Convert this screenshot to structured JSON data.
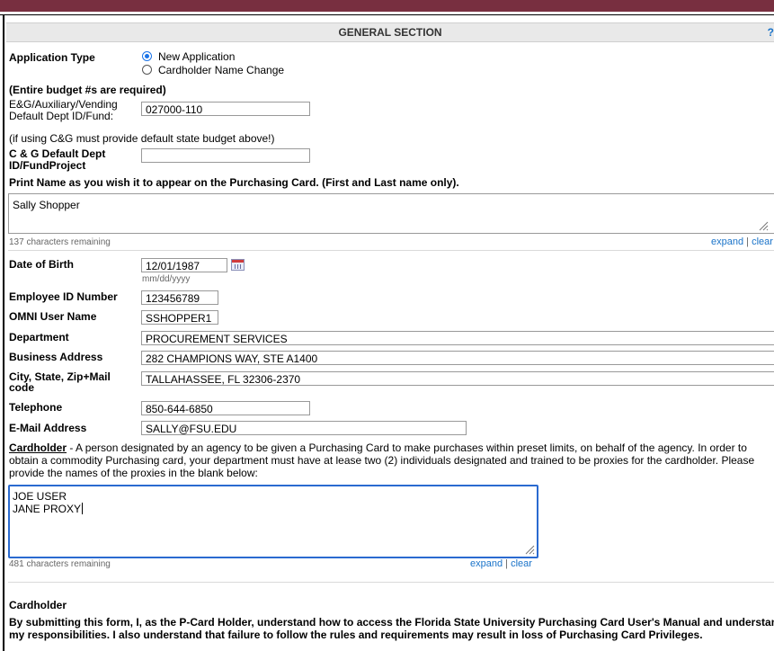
{
  "section": {
    "title": "GENERAL SECTION",
    "help": "?"
  },
  "application_type": {
    "label": "Application Type",
    "options": [
      {
        "label": "New Application",
        "selected": true
      },
      {
        "label": "Cardholder Name Change",
        "selected": false
      }
    ]
  },
  "budget_note": "(Entire budget #s are required)",
  "eg_fund": {
    "label_line1": "E&G/Auxiliary/Vending",
    "label_line2": "Default Dept ID/Fund:",
    "value": "027000-110"
  },
  "cg_note": "(if using C&G must provide default state budget above!)",
  "cg_fund": {
    "label_line1": "C & G Default Dept",
    "label_line2": "ID/FundProject",
    "value": ""
  },
  "print_name": {
    "label": "Print Name as you wish it to appear on the Purchasing Card. (First and Last name only).",
    "value": "Sally Shopper",
    "remaining": "137 characters remaining",
    "expand": "expand",
    "separator": "|",
    "clear": "clear"
  },
  "dob": {
    "label": "Date of Birth",
    "value": "12/01/1987",
    "format_hint": "mm/dd/yyyy"
  },
  "employee_id": {
    "label": "Employee ID Number",
    "value": "123456789"
  },
  "omni_user": {
    "label": "OMNI User Name",
    "value": "SSHOPPER1"
  },
  "department": {
    "label": "Department",
    "value": "PROCUREMENT SERVICES"
  },
  "business_address": {
    "label": "Business Address",
    "value": "282 CHAMPIONS WAY, STE A1400"
  },
  "city_state": {
    "label_line1": "City, State, Zip+Mail",
    "label_line2": "code",
    "value": "TALLAHASSEE, FL 32306-2370"
  },
  "telephone": {
    "label": "Telephone",
    "value": "850-644-6850"
  },
  "email": {
    "label": "E-Mail Address",
    "value": "SALLY@FSU.EDU"
  },
  "cardholder_def": {
    "term": "Cardholder",
    "line1": " - A person designated by an agency to be given a Purchasing Card to make purchases within preset limits, on behalf of the agency. In order to",
    "line2": "obtain a commodity Purchasing card, your department must have at lease two (2) individuals designated and trained to be proxies for the cardholder. Please",
    "line3": "provide the names of the proxies in the blank below:"
  },
  "proxies": {
    "line1": "JOE USER",
    "line2": "JANE PROXY",
    "remaining": "481 characters remaining",
    "expand": "expand",
    "separator": "|",
    "clear": "clear"
  },
  "cardholder_section": {
    "title": "Cardholder",
    "statement_line1": "By submitting this form, I, as the P-Card Holder, understand how to access the Florida State University Purchasing Card User's Manual and understand",
    "statement_line2": "my responsibilities. I also understand that failure to follow the rules and requirements may result in loss of Purchasing Card Privileges."
  }
}
